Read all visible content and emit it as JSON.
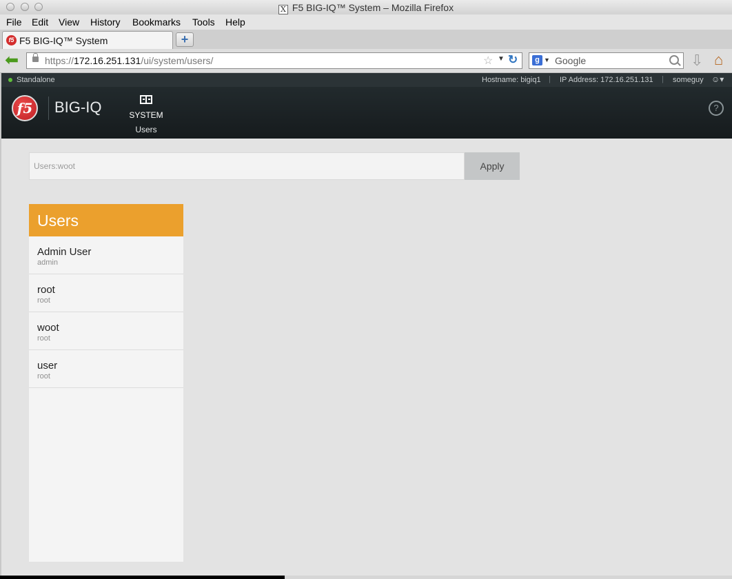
{
  "window": {
    "title": "F5 BIG-IQ™ System – Mozilla Firefox",
    "x_glyph": "X"
  },
  "menu": [
    "File",
    "Edit",
    "View",
    "History",
    "Bookmarks",
    "Tools",
    "Help"
  ],
  "tab": {
    "title": "F5 BIG-IQ™ System",
    "favicon": "f5",
    "new_tab": "+"
  },
  "nav": {
    "url_scheme": "https://",
    "url_host": "172.16.251.131",
    "url_path": "/ui/system/users/",
    "search_engine": "g",
    "search_placeholder": "Google"
  },
  "status": {
    "mode": "Standalone",
    "hostname": "Hostname: bigiq1",
    "ip": "IP Address: 172.16.251.131",
    "user": "someguy",
    "separator": "|"
  },
  "header": {
    "logo": "f5",
    "product": "BIG-IQ",
    "nav_section": "SYSTEM",
    "nav_subsection": "Users",
    "help": "?"
  },
  "filter": {
    "value": "Users:woot",
    "apply_label": "Apply"
  },
  "users_panel": {
    "title": "Users",
    "items": [
      {
        "name": "Admin User",
        "sub": "admin"
      },
      {
        "name": "root",
        "sub": "root"
      },
      {
        "name": "woot",
        "sub": "root"
      },
      {
        "name": "user",
        "sub": "root"
      }
    ]
  },
  "colors": {
    "accent_orange": "#eba02d",
    "header_dark": "#222a2d",
    "status_green": "#5fbf3a"
  }
}
